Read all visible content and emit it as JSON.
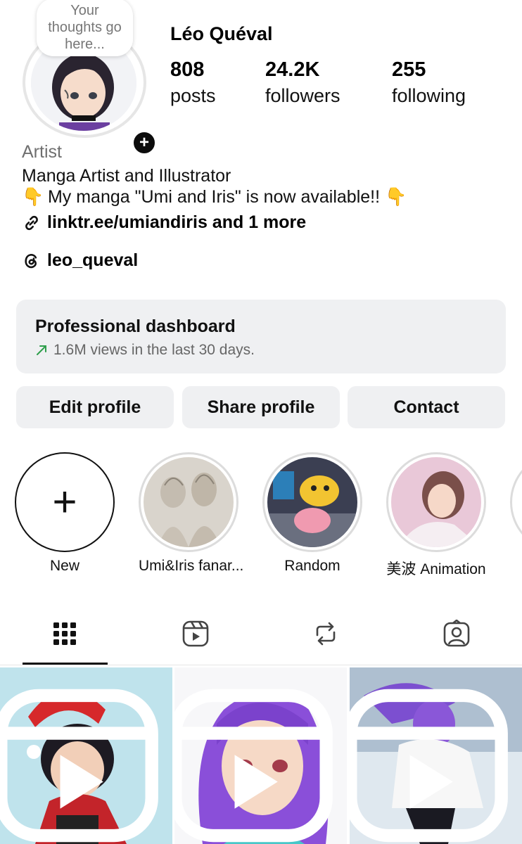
{
  "profile": {
    "thought_placeholder": "Your thoughts go here...",
    "username": "Léo Quéval",
    "stats": [
      {
        "value": "808",
        "label": "posts"
      },
      {
        "value": "24.2K",
        "label": "followers"
      },
      {
        "value": "255",
        "label": "following"
      }
    ],
    "category": "Artist",
    "bio_line1": "Manga Artist and Illustrator",
    "bio_line2": "My manga \"Umi and Iris\" is now available!!",
    "bio_emoji": "👇",
    "link_text": "linktr.ee/umiandiris and 1 more",
    "threads_handle": "leo_queval"
  },
  "dashboard": {
    "title": "Professional dashboard",
    "subtitle": "1.6M views in the last 30 days."
  },
  "buttons": {
    "edit": "Edit profile",
    "share": "Share profile",
    "contact": "Contact"
  },
  "highlights": [
    {
      "label": "New"
    },
    {
      "label": "Umi&Iris fanar..."
    },
    {
      "label": "Random"
    },
    {
      "label": "美波 Animation"
    }
  ],
  "tabs": [
    "grid-icon",
    "reels-icon",
    "reposts-icon",
    "tagged-icon"
  ],
  "colors": {
    "accent_dark": "#0c0c0c",
    "button_bg": "#eff0f2",
    "trend_green": "#2e9e4b",
    "muted_text": "#6f6f6f"
  }
}
